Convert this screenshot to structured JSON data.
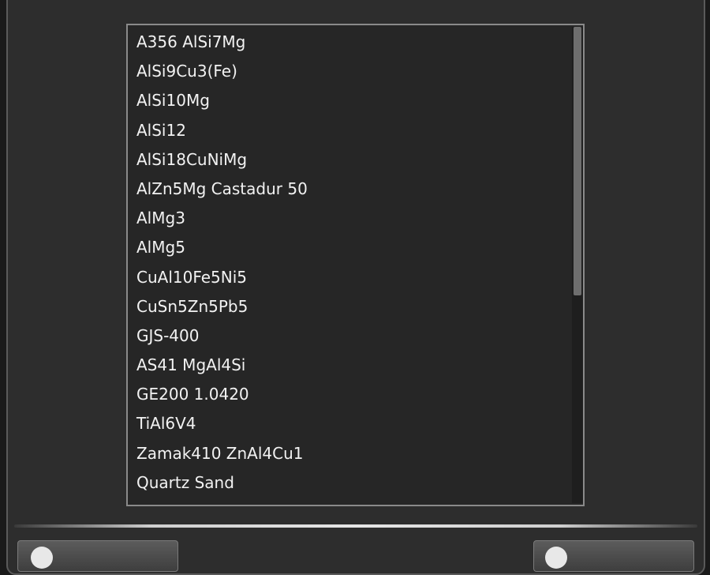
{
  "materials": {
    "items": [
      "A356 AlSi7Mg",
      "AlSi9Cu3(Fe)",
      "AlSi10Mg",
      "AlSi12",
      "AlSi18CuNiMg",
      "AlZn5Mg Castadur 50",
      "AlMg3",
      "AlMg5",
      "CuAl10Fe5Ni5",
      "CuSn5Zn5Pb5",
      "GJS-400",
      "AS41 MgAl4Si",
      "GE200 1.0420",
      "TiAl6V4",
      "Zamak410 ZnAl4Cu1",
      "Quartz Sand"
    ]
  },
  "icons": {
    "left_button_icon": "circle-icon",
    "right_button_icon": "circle-icon"
  },
  "colors": {
    "panel_background": "#2d2d2d",
    "list_background": "#262626",
    "list_border": "#8a8a8a",
    "text": "#f2f2f2"
  }
}
